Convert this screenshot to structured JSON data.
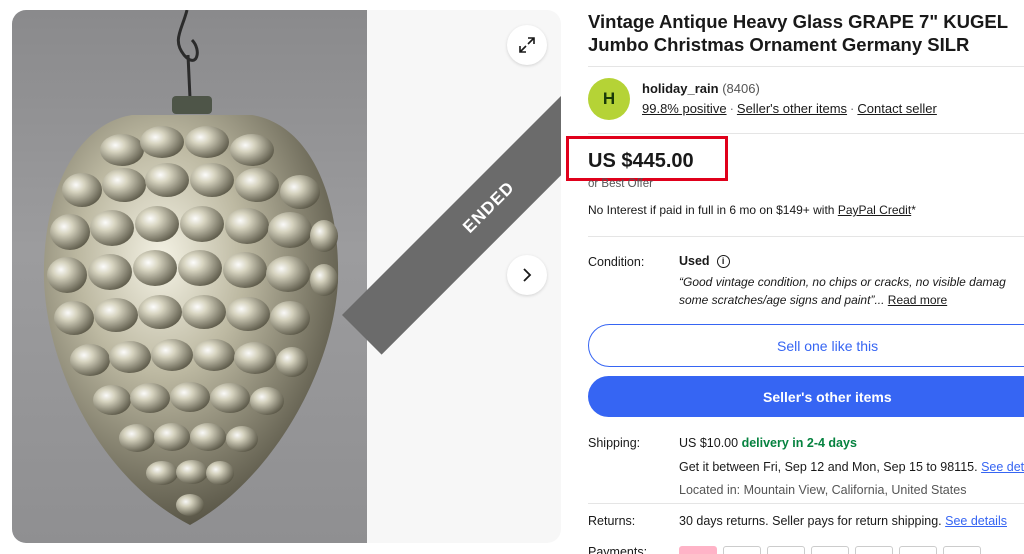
{
  "listing": {
    "title": "Vintage Antique Heavy Glass GRAPE 7\" KUGEL Jumbo Christmas Ornament Germany SILR",
    "ended_label": "ENDED"
  },
  "seller": {
    "avatar_letter": "H",
    "name": "holiday_rain",
    "feedback_count": "(8406)",
    "positive": "99.8% positive",
    "other_items_link": "Seller's other items",
    "contact_link": "Contact seller"
  },
  "price": {
    "amount": "US $445.00",
    "best_offer": "or Best Offer",
    "finance_text": "No Interest if paid in full in 6 mo on $149+ with ",
    "finance_link": "PayPal Credit",
    "finance_suffix": "*"
  },
  "condition": {
    "label": "Condition:",
    "value": "Used",
    "quote_open": "“",
    "line1": "Good vintage condition, no chips or cracks, no visible damag",
    "line2": "some scratches/age signs and paint",
    "quote_close": "”...",
    "read_more": "Read more"
  },
  "buttons": {
    "sell_one": "Sell one like this",
    "sellers_other": "Seller's other items"
  },
  "shipping": {
    "label": "Shipping:",
    "cost": "US $10.00",
    "delivery": "delivery in 2-4 days",
    "estimate": "Get it between Fri, Sep 12 and Mon, Sep 15 to 98115.",
    "see_details": "See details",
    "located": "Located in: Mountain View, California, United States"
  },
  "returns": {
    "label": "Returns:",
    "text": "30 days returns. Seller pays for return shipping.",
    "see_details": "See details"
  },
  "payments": {
    "label": "Payments:"
  },
  "icons": {
    "expand": "expand-icon",
    "next": "chevron-right-icon",
    "info": "info-icon"
  },
  "colors": {
    "accent": "#3665f3",
    "highlight_box": "#e0001b",
    "delivery_green": "#05823f",
    "avatar_bg": "#b5d336",
    "ended_ribbon": "#6b6b6b"
  }
}
